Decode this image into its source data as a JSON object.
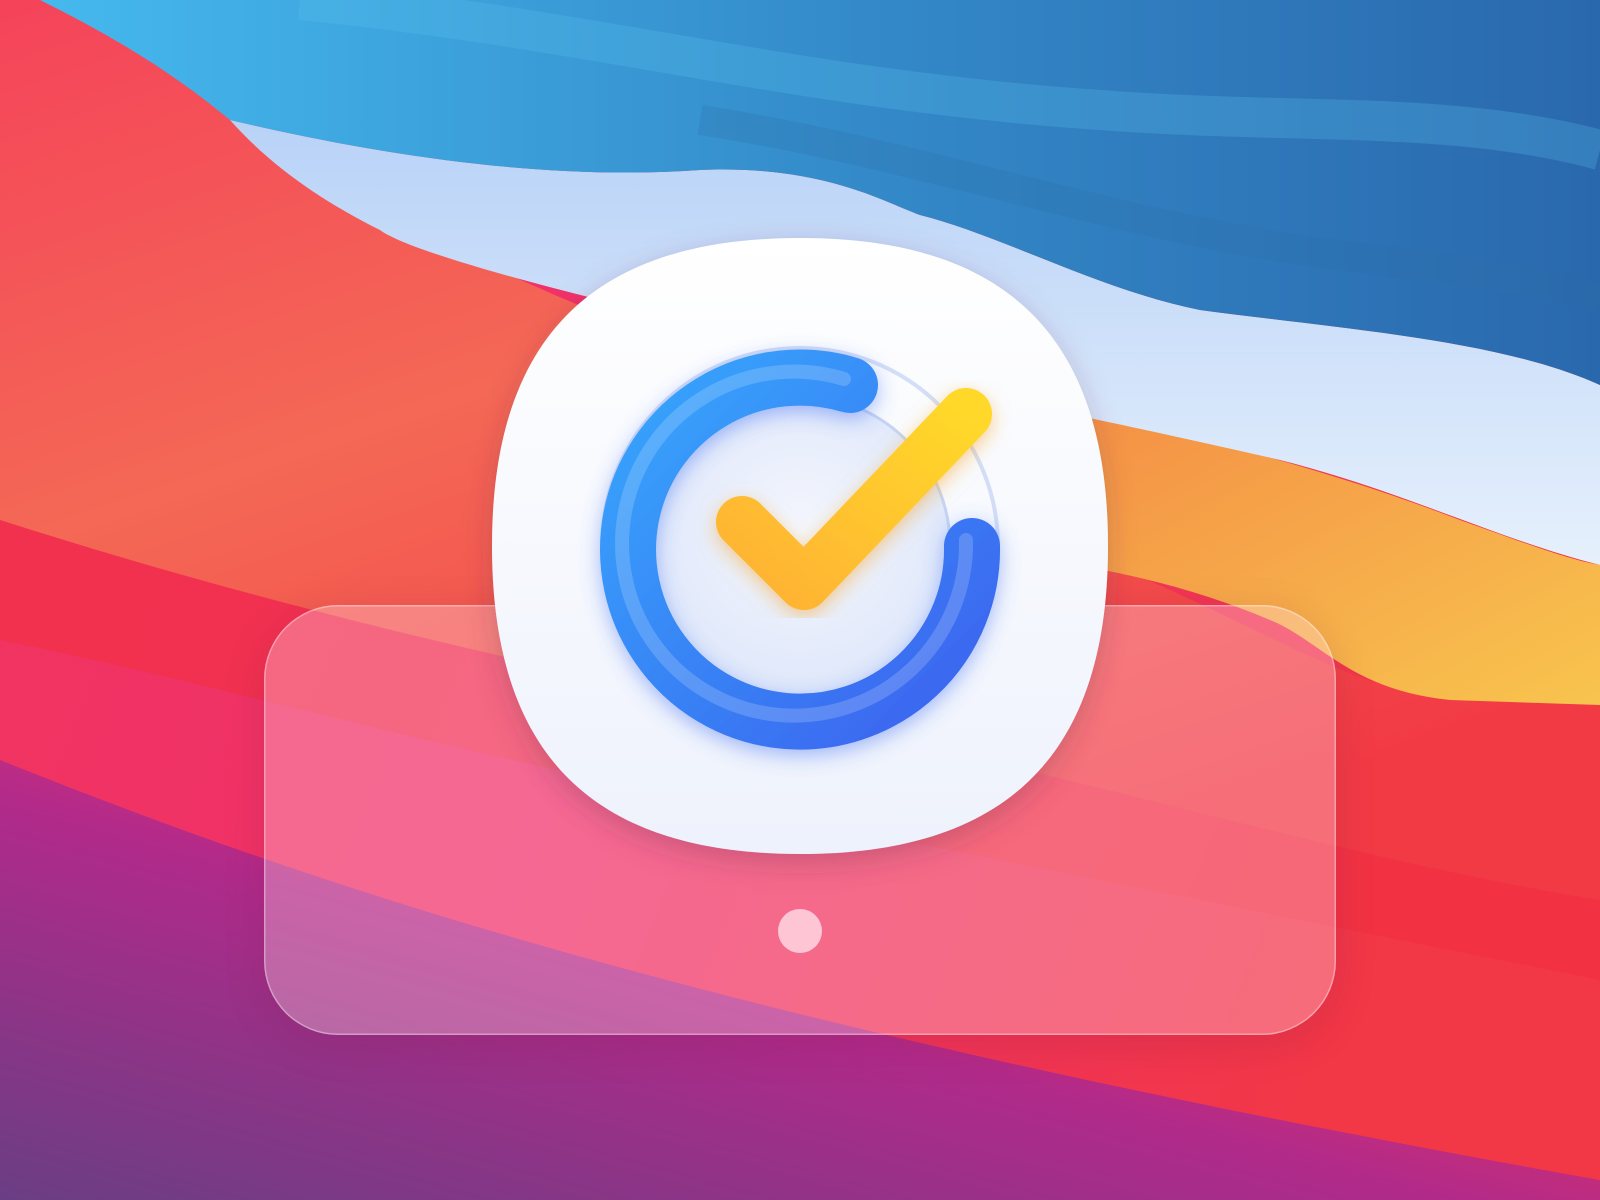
{
  "desktop": {
    "wallpaper": "macos-big-sur-wave",
    "colors": {
      "sky_blue": "#3fb2ea",
      "deep_blue": "#2b6fb0",
      "pale_blue": "#cfe2fa",
      "red": "#f2343f",
      "coral": "#f6705a",
      "orange": "#f5a33f",
      "pink": "#f3306c",
      "purple": "#6d3c86"
    }
  },
  "dock": {
    "material": "frosted-translucent",
    "app": {
      "icon": "checkmark-circle-progress-icon",
      "running": true,
      "colors": {
        "tile": "#ffffff",
        "ring": "#3a8ff7",
        "check": "#ffc52a"
      }
    }
  }
}
